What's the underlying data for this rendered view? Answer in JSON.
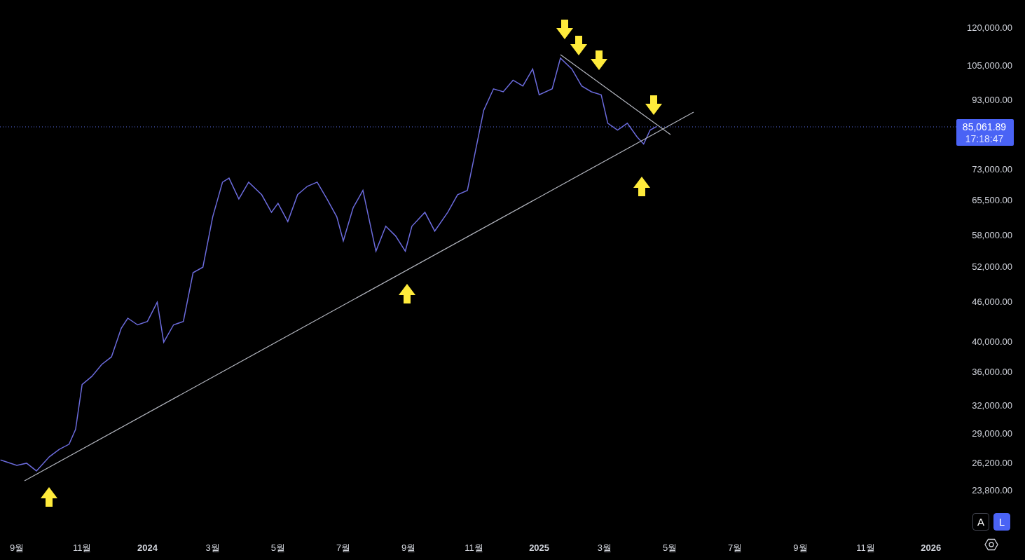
{
  "chart": {
    "price_axis": {
      "labels": [
        "120,000.00",
        "105,000.00",
        "93,000.00",
        "73,000.00",
        "65,500.00",
        "58,000.00",
        "52,000.00",
        "46,000.00",
        "40,000.00",
        "36,000.00",
        "32,000.00",
        "29,000.00",
        "26,200.00",
        "23,800.00"
      ]
    },
    "time_axis": {
      "labels": [
        {
          "label": "9월",
          "kind": "month"
        },
        {
          "label": "11월",
          "kind": "month"
        },
        {
          "label": "2024",
          "kind": "year"
        },
        {
          "label": "3월",
          "kind": "month"
        },
        {
          "label": "5월",
          "kind": "month"
        },
        {
          "label": "7월",
          "kind": "month"
        },
        {
          "label": "9월",
          "kind": "month"
        },
        {
          "label": "11월",
          "kind": "month"
        },
        {
          "label": "2025",
          "kind": "year"
        },
        {
          "label": "3월",
          "kind": "month"
        },
        {
          "label": "5월",
          "kind": "month"
        },
        {
          "label": "7월",
          "kind": "month"
        },
        {
          "label": "9월",
          "kind": "month"
        },
        {
          "label": "11월",
          "kind": "month"
        },
        {
          "label": "2026",
          "kind": "year"
        }
      ]
    },
    "current_price": {
      "label": "85,061.89",
      "countdown": "17:18:47"
    }
  },
  "scale_buttons": [
    {
      "label": "A",
      "selected": false
    },
    {
      "label": "L",
      "selected": true
    }
  ]
}
